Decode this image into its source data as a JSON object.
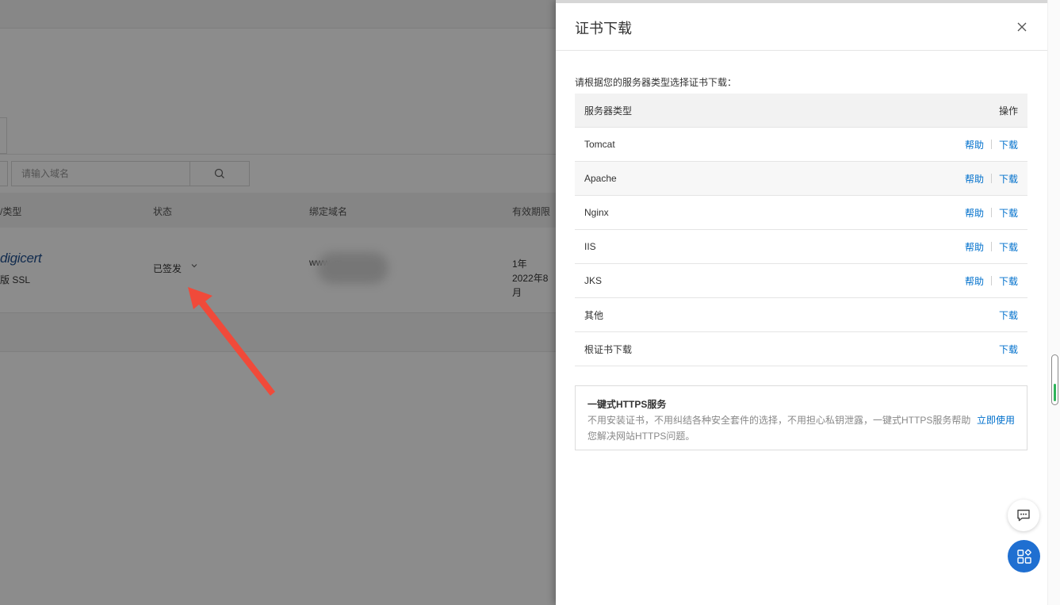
{
  "background": {
    "search": {
      "placeholder": "请输入域名"
    },
    "table": {
      "headers": [
        "/类型",
        "状态",
        "绑定域名",
        "有效期限"
      ],
      "row": {
        "brand": "digicert",
        "product": "版 SSL",
        "status": "已签发",
        "domain": "www.         m",
        "validity": "1年",
        "expiry": "2022年8月"
      }
    }
  },
  "drawer": {
    "title": "证书下载",
    "intro": "请根据您的服务器类型选择证书下载：",
    "table": {
      "col_server": "服务器类型",
      "col_ops": "操作",
      "rows": [
        {
          "name": "Tomcat",
          "help": "帮助",
          "download": "下载"
        },
        {
          "name": "Apache",
          "help": "帮助",
          "download": "下载"
        },
        {
          "name": "Nginx",
          "help": "帮助",
          "download": "下载"
        },
        {
          "name": "IIS",
          "help": "帮助",
          "download": "下载"
        },
        {
          "name": "JKS",
          "help": "帮助",
          "download": "下载"
        },
        {
          "name": "其他",
          "download": "下载"
        },
        {
          "name": "根证书下载",
          "download": "下载"
        }
      ]
    },
    "promo": {
      "title": "一键式HTTPS服务",
      "desc": "不用安装证书，不用纠结各种安全套件的选择，不用担心私钥泄露，一键式HTTPS服务帮助您解决网站HTTPS问题。",
      "action": "立即使用"
    }
  },
  "icons": {
    "close": "close-icon",
    "search": "search-icon",
    "chat": "chat-icon",
    "apps": "apps-icon"
  },
  "colors": {
    "link": "#0070cc",
    "apps_button": "#1f6fd1",
    "arrow": "#f04a3a"
  }
}
